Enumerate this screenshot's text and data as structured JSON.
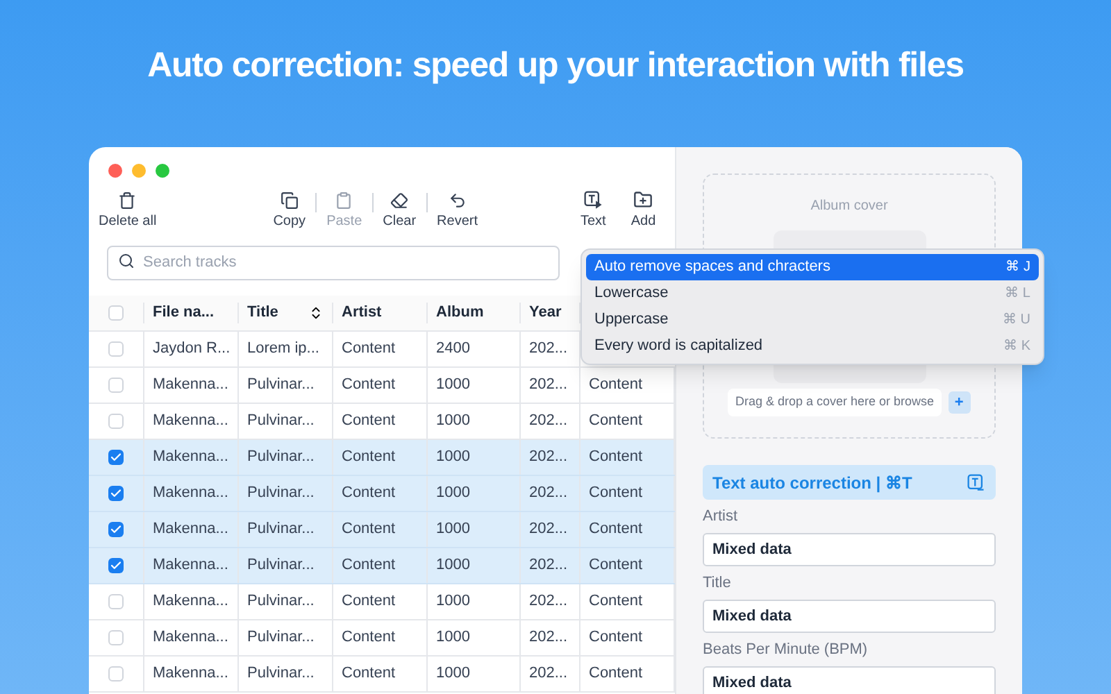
{
  "headline": "Auto correction: speed up your interaction with files",
  "toolbar": {
    "left": [
      {
        "label": "Delete all",
        "disabled": false
      }
    ],
    "edit": [
      {
        "label": "Copy",
        "disabled": false
      },
      {
        "label": "Paste",
        "disabled": true
      },
      {
        "label": "Clear",
        "disabled": false
      },
      {
        "label": "Revert",
        "disabled": false
      }
    ],
    "right": [
      {
        "label": "Text",
        "disabled": false
      },
      {
        "label": "Add",
        "disabled": false
      }
    ]
  },
  "search": {
    "placeholder": "Search tracks"
  },
  "table": {
    "header_checked": false,
    "columns": [
      "File na...",
      "Title",
      "Artist",
      "Album",
      "Year"
    ],
    "rows": [
      {
        "checked": false,
        "cells": [
          "Jaydon R...",
          "Lorem ip...",
          "Content",
          "2400",
          "202..."
        ]
      },
      {
        "checked": false,
        "cells": [
          "Makenna...",
          "Pulvinar...",
          "Content",
          "1000",
          "202...",
          "Content"
        ]
      },
      {
        "checked": false,
        "cells": [
          "Makenna...",
          "Pulvinar...",
          "Content",
          "1000",
          "202...",
          "Content"
        ]
      },
      {
        "checked": true,
        "cells": [
          "Makenna...",
          "Pulvinar...",
          "Content",
          "1000",
          "202...",
          "Content"
        ]
      },
      {
        "checked": true,
        "cells": [
          "Makenna...",
          "Pulvinar...",
          "Content",
          "1000",
          "202...",
          "Content"
        ]
      },
      {
        "checked": true,
        "cells": [
          "Makenna...",
          "Pulvinar...",
          "Content",
          "1000",
          "202...",
          "Content"
        ]
      },
      {
        "checked": true,
        "cells": [
          "Makenna...",
          "Pulvinar...",
          "Content",
          "1000",
          "202...",
          "Content"
        ]
      },
      {
        "checked": false,
        "cells": [
          "Makenna...",
          "Pulvinar...",
          "Content",
          "1000",
          "202...",
          "Content"
        ]
      },
      {
        "checked": false,
        "cells": [
          "Makenna...",
          "Pulvinar...",
          "Content",
          "1000",
          "202...",
          "Content"
        ]
      },
      {
        "checked": false,
        "cells": [
          "Makenna...",
          "Pulvinar...",
          "Content",
          "1000",
          "202...",
          "Content"
        ]
      }
    ]
  },
  "menu": [
    {
      "label": "Auto remove spaces and chracters",
      "shortcut": "⌘ J",
      "selected": true
    },
    {
      "label": "Lowercase",
      "shortcut": "⌘ L",
      "selected": false
    },
    {
      "label": "Uppercase",
      "shortcut": "⌘ U",
      "selected": false
    },
    {
      "label": "Every word is capitalized",
      "shortcut": "⌘ K",
      "selected": false
    }
  ],
  "cover": {
    "title": "Album cover",
    "drop_hint": "Drag & drop a cover here or browse",
    "add_label": "+"
  },
  "auto_correction": {
    "label": "Text auto correction | ⌘T"
  },
  "fields": [
    {
      "label": "Artist",
      "value": "Mixed data"
    },
    {
      "label": "Title",
      "value": "Mixed data"
    },
    {
      "label": "Beats Per Minute (BPM)",
      "value": "Mixed data"
    }
  ]
}
